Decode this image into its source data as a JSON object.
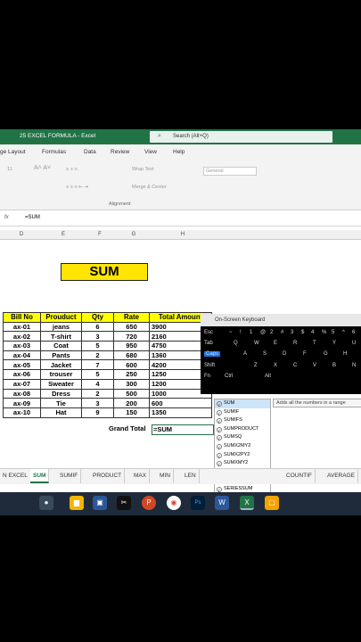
{
  "titlebar": {
    "title": "25 EXCEL FORMULA  -  Excel",
    "search": "Search (Alt+Q)"
  },
  "tabs": [
    "ge Layout",
    "Formulas",
    "Data",
    "Review",
    "View",
    "Help"
  ],
  "ribbon": {
    "font_size": "11",
    "wrap_text": "Wrap Text",
    "merge_center": "Merge & Center",
    "number_format": "General",
    "alignment_label": "Alignment"
  },
  "formula_bar": {
    "fx": "fx",
    "content": "=SUM"
  },
  "columns": [
    "D",
    "E",
    "F",
    "G",
    "H"
  ],
  "title_box": "SUM",
  "table": {
    "headers": [
      "Bill No",
      "Prouduct",
      "Qty",
      "Rate",
      "Total Amount"
    ],
    "rows": [
      [
        "ax-01",
        "jeans",
        "6",
        "650",
        "3900"
      ],
      [
        "ax-02",
        "T-shirt",
        "3",
        "720",
        "2160"
      ],
      [
        "ax-03",
        "Coat",
        "5",
        "950",
        "4750"
      ],
      [
        "ax-04",
        "Pants",
        "2",
        "680",
        "1360"
      ],
      [
        "ax-05",
        "Jacket",
        "7",
        "600",
        "4200"
      ],
      [
        "ax-06",
        "trouser",
        "5",
        "250",
        "1250"
      ],
      [
        "ax-07",
        "Sweater",
        "4",
        "300",
        "1200"
      ],
      [
        "ax-08",
        "Dress",
        "2",
        "500",
        "1000"
      ],
      [
        "ax-09",
        "Tie",
        "3",
        "200",
        "600"
      ],
      [
        "ax-10",
        "Hat",
        "9",
        "150",
        "1350"
      ]
    ]
  },
  "grand_total_label": "Grand Total",
  "active_cell": "=SUM",
  "autocomplete": [
    "SUM",
    "SUMIF",
    "SUMIFS",
    "SUMPRODUCT",
    "SUMSQ",
    "SUMX2MY2",
    "SUMX2PY2",
    "SUMXMY2",
    "DSUM",
    "IMSUM",
    "SERIESSUM"
  ],
  "tooltip": "Adds all the numbers in a range",
  "sheet_tabs": [
    "N EXCEL",
    "SUM",
    "SUMIF",
    "PRODUCT",
    "MAX",
    "MIN",
    "LEN",
    "COUNTIF",
    "AVERAGE"
  ],
  "active_sheet": "SUM",
  "osk": {
    "title": "On-Screen Keyboard",
    "row1": [
      "Esc",
      "~",
      "!",
      "1",
      "@",
      "2",
      "#",
      "3",
      "$",
      "4",
      "%",
      "5",
      "^",
      "6"
    ],
    "row2": [
      "Tab",
      "Q",
      "W",
      "E",
      "R",
      "T",
      "Y",
      "U"
    ],
    "row3": [
      "Caps",
      "A",
      "S",
      "D",
      "F",
      "G",
      "H"
    ],
    "row4": [
      "Shift",
      "Z",
      "X",
      "C",
      "V",
      "B",
      "N"
    ],
    "row5": [
      "Fn",
      "Ctrl",
      "Alt"
    ]
  }
}
